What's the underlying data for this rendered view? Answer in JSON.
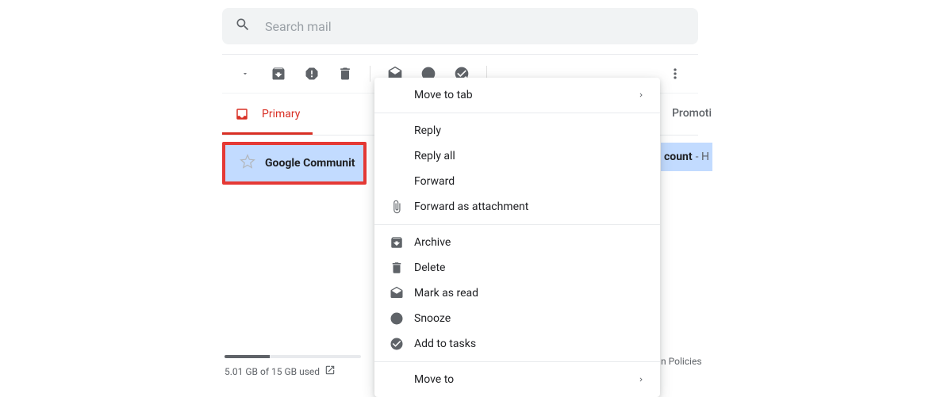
{
  "search": {
    "placeholder": "Search mail"
  },
  "toolbar": {},
  "tabs": {
    "primary": "Primary",
    "promotions": "Promoti"
  },
  "email": {
    "sender": "Google Communit",
    "subject_bold": "count",
    "subject_gray": " - H"
  },
  "menu": {
    "move_to_tab": "Move to tab",
    "reply": "Reply",
    "reply_all": "Reply all",
    "forward": "Forward",
    "forward_attachment": "Forward as attachment",
    "archive": "Archive",
    "delete": "Delete",
    "mark_as_read": "Mark as read",
    "snooze": "Snooze",
    "add_to_tasks": "Add to tasks",
    "move_to": "Move to"
  },
  "footer": {
    "storage": "5.01 GB of 15 GB used",
    "policies": "n Policies"
  }
}
